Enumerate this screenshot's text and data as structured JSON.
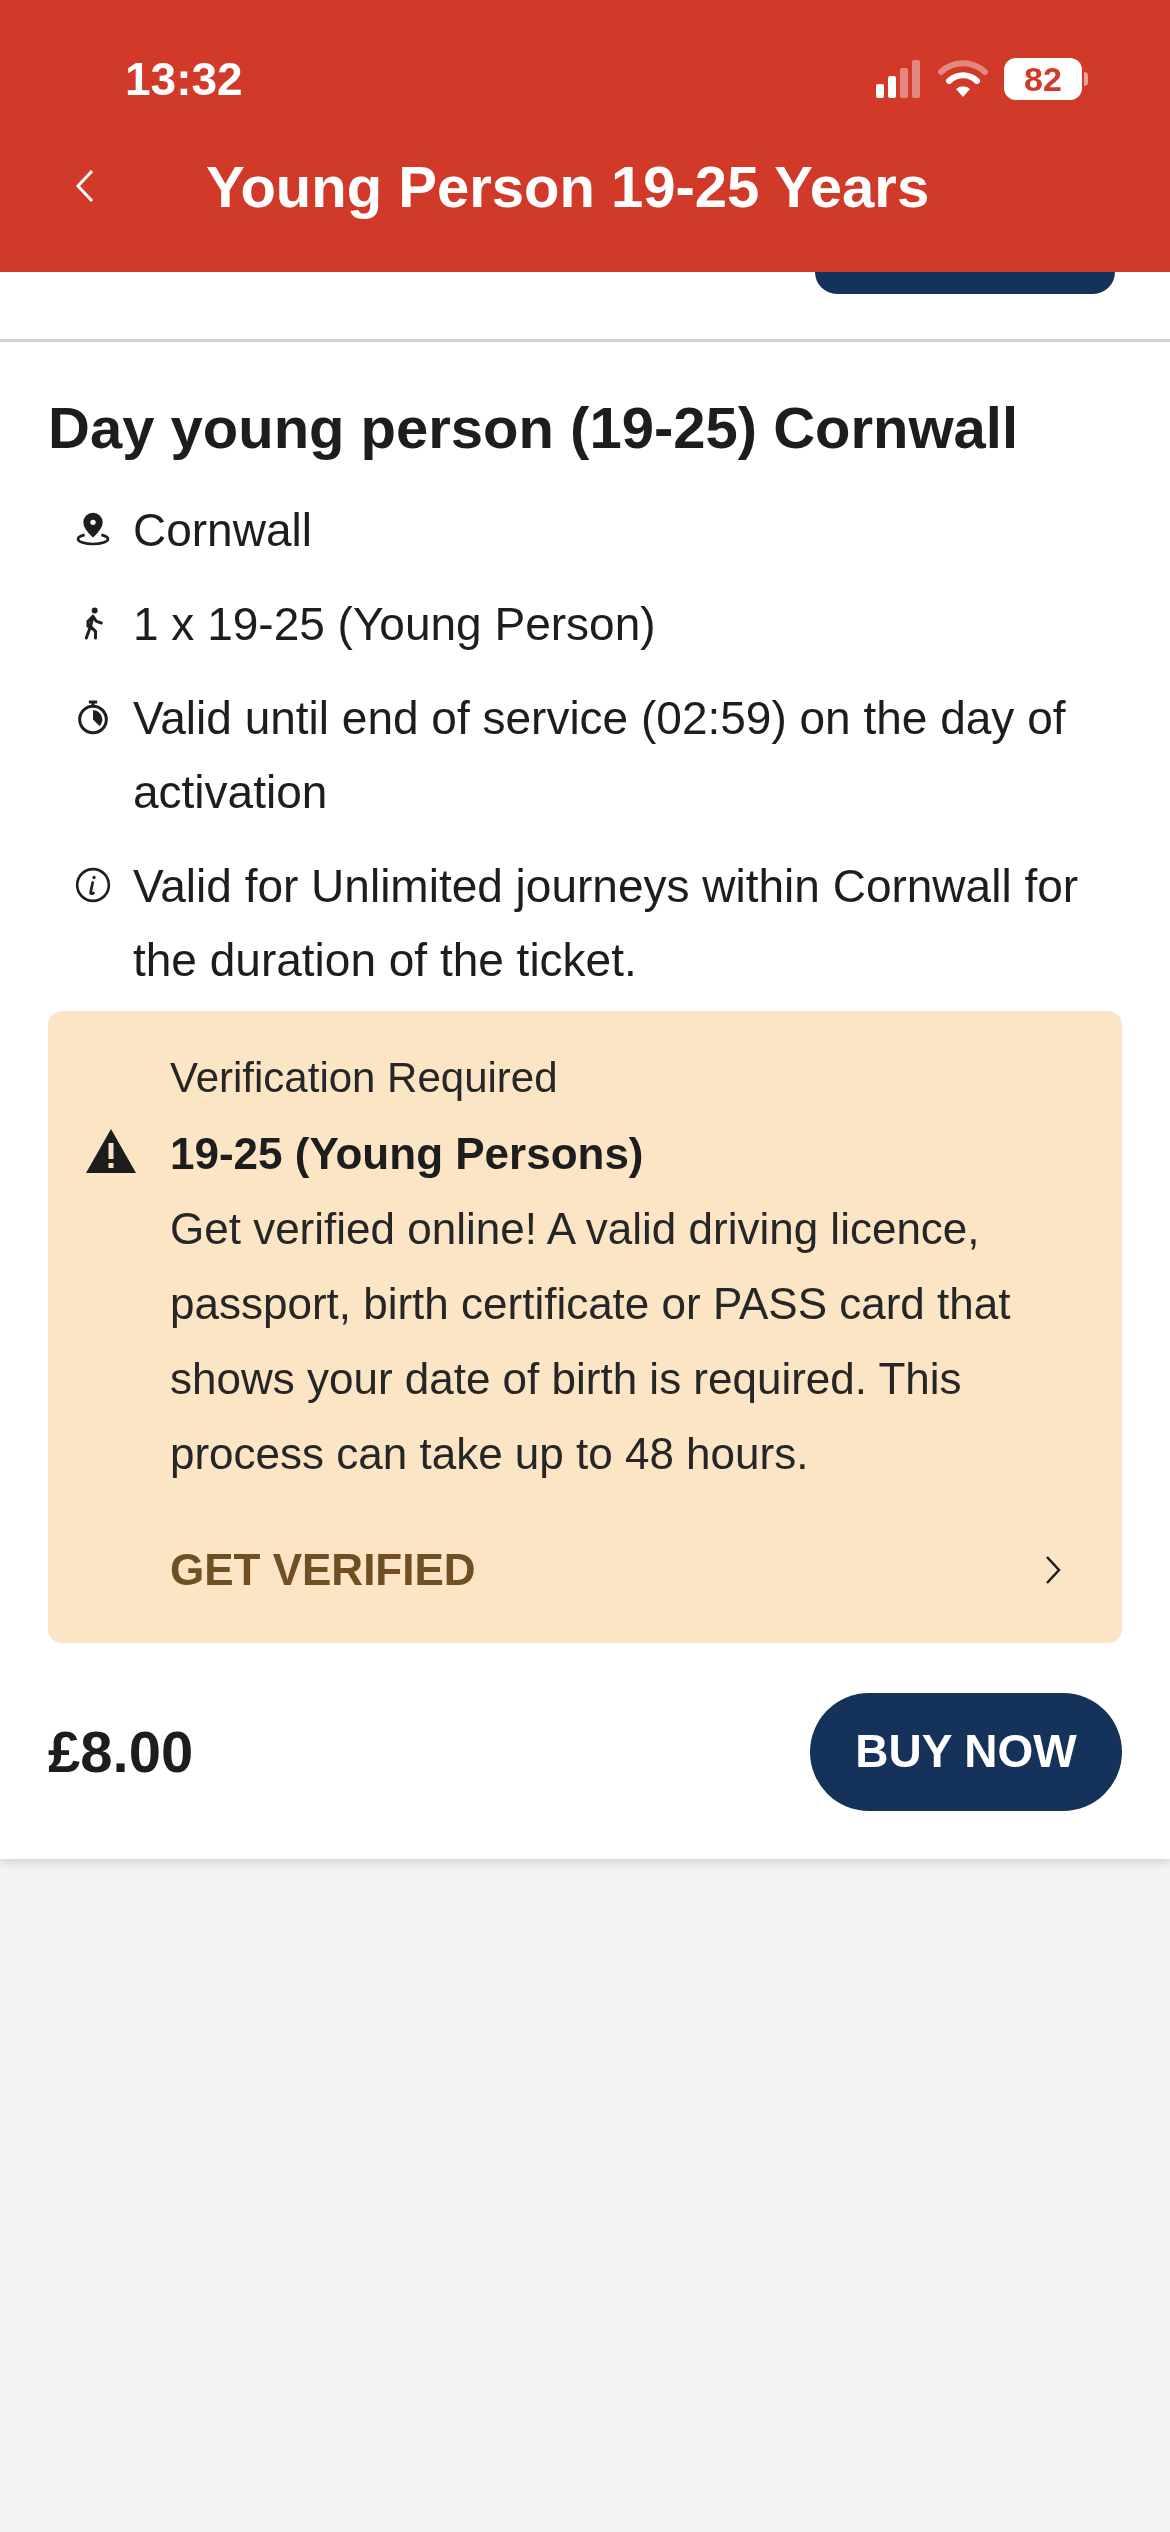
{
  "status_bar": {
    "time": "13:32",
    "battery": "82"
  },
  "header": {
    "title": "Young Person 19-25 Years"
  },
  "ticket": {
    "title": "Day young person (19-25) Cornwall",
    "details": [
      {
        "kind": "location",
        "text": "Cornwall"
      },
      {
        "kind": "passenger",
        "text": "1 x 19-25 (Young Person)"
      },
      {
        "kind": "timer",
        "text": "Valid until end of service (02:59) on the day of activation"
      },
      {
        "kind": "info",
        "text": "Valid for Unlimited journeys within Cornwall for the duration of the ticket."
      }
    ],
    "notice": {
      "heading": "Verification Required",
      "subheading": "19-25 (Young Persons)",
      "body": "Get verified online! A valid driving licence, passport, birth certificate or PASS card that shows your date of birth is required. This process can take up to 48 hours.",
      "action": "GET VERIFIED"
    },
    "price": "£8.00",
    "buy_button": "BUY NOW"
  }
}
